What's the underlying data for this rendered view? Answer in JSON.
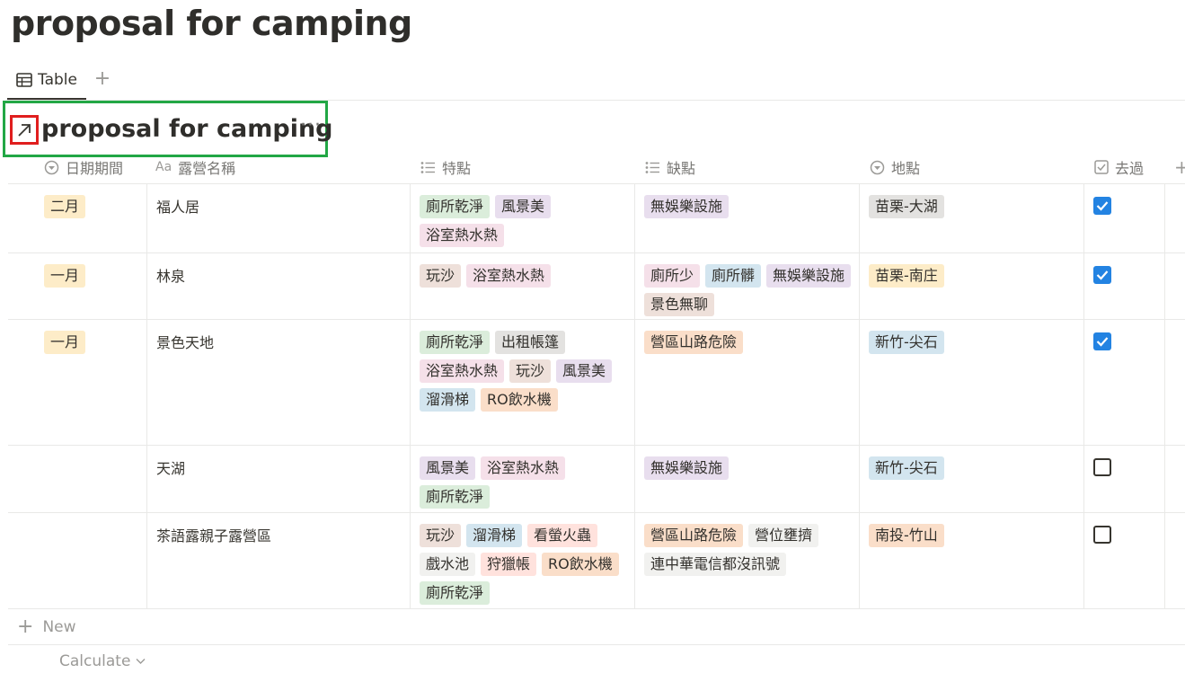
{
  "page": {
    "title": "proposal for camping"
  },
  "views": {
    "tabs": [
      {
        "label": "Table"
      }
    ],
    "add_label": "+"
  },
  "database": {
    "title": "proposal for camping",
    "more": "···"
  },
  "columns": [
    {
      "label": "日期期間",
      "icon": "select-icon"
    },
    {
      "label": "露營名稱",
      "icon": "title-aa-icon"
    },
    {
      "label": "特點",
      "icon": "list-icon"
    },
    {
      "label": "缺點",
      "icon": "list-icon"
    },
    {
      "label": "地點",
      "icon": "select-icon"
    },
    {
      "label": "去過",
      "icon": "checkbox-icon"
    }
  ],
  "colors": {
    "yellow": "#fdecc8",
    "green": "#dbeddb",
    "purple": "#e8deee",
    "pink": "#f5e0e9",
    "brown": "#eee0da",
    "blue": "#d3e5ef",
    "gray": "#e3e2e0",
    "orange": "#fadec9",
    "red": "#ffe2dd",
    "lightgray": "#f1f1ef",
    "check_blue": "#2383e2",
    "header_green_outline": "#22a745",
    "link_red_outline": "#e01e1e"
  },
  "rows": [
    {
      "date": {
        "label": "二月",
        "color": "yellow"
      },
      "name": "福人居",
      "features": [
        {
          "label": "廁所乾淨",
          "color": "green"
        },
        {
          "label": "風景美",
          "color": "purple"
        },
        {
          "label": "浴室熱水熱",
          "color": "pink"
        }
      ],
      "cons": [
        {
          "label": "無娛樂設施",
          "color": "purple"
        }
      ],
      "location": {
        "label": "苗栗-大湖",
        "color": "gray"
      },
      "visited": true
    },
    {
      "date": {
        "label": "一月",
        "color": "yellow"
      },
      "name": "林泉",
      "features": [
        {
          "label": "玩沙",
          "color": "brown"
        },
        {
          "label": "浴室熱水熱",
          "color": "pink"
        }
      ],
      "cons": [
        {
          "label": "廁所少",
          "color": "pink"
        },
        {
          "label": "廁所髒",
          "color": "blue"
        },
        {
          "label": "無娛樂設施",
          "color": "purple"
        },
        {
          "label": "景色無聊",
          "color": "brown"
        }
      ],
      "location": {
        "label": "苗栗-南庄",
        "color": "yellow"
      },
      "visited": true
    },
    {
      "date": {
        "label": "一月",
        "color": "yellow"
      },
      "name": "景色天地",
      "features": [
        {
          "label": "廁所乾淨",
          "color": "green"
        },
        {
          "label": "出租帳篷",
          "color": "gray"
        },
        {
          "label": "浴室熱水熱",
          "color": "pink"
        },
        {
          "label": "玩沙",
          "color": "brown"
        },
        {
          "label": "風景美",
          "color": "purple"
        },
        {
          "label": "溜滑梯",
          "color": "blue"
        },
        {
          "label": "RO飲水機",
          "color": "orange"
        }
      ],
      "cons": [
        {
          "label": "營區山路危險",
          "color": "orange"
        }
      ],
      "location": {
        "label": "新竹-尖石",
        "color": "blue"
      },
      "visited": true
    },
    {
      "date": null,
      "name": "天湖",
      "features": [
        {
          "label": "風景美",
          "color": "purple"
        },
        {
          "label": "浴室熱水熱",
          "color": "pink"
        },
        {
          "label": "廁所乾淨",
          "color": "green"
        }
      ],
      "cons": [
        {
          "label": "無娛樂設施",
          "color": "purple"
        }
      ],
      "location": {
        "label": "新竹-尖石",
        "color": "blue"
      },
      "visited": false
    },
    {
      "date": null,
      "name": "茶語露親子露營區",
      "features": [
        {
          "label": "玩沙",
          "color": "brown"
        },
        {
          "label": "溜滑梯",
          "color": "blue"
        },
        {
          "label": "看螢火蟲",
          "color": "red"
        },
        {
          "label": "戲水池",
          "color": "lightgray"
        },
        {
          "label": "狩獵帳",
          "color": "red"
        },
        {
          "label": "RO飲水機",
          "color": "orange"
        },
        {
          "label": "廁所乾淨",
          "color": "green"
        }
      ],
      "cons": [
        {
          "label": "營區山路危險",
          "color": "orange"
        },
        {
          "label": "營位壅擠",
          "color": "lightgray"
        },
        {
          "label": "連中華電信都沒訊號",
          "color": "lightgray"
        }
      ],
      "location": {
        "label": "南投-竹山",
        "color": "orange"
      },
      "visited": false
    }
  ],
  "footer": {
    "new_label": "New",
    "calculate_label": "Calculate"
  }
}
